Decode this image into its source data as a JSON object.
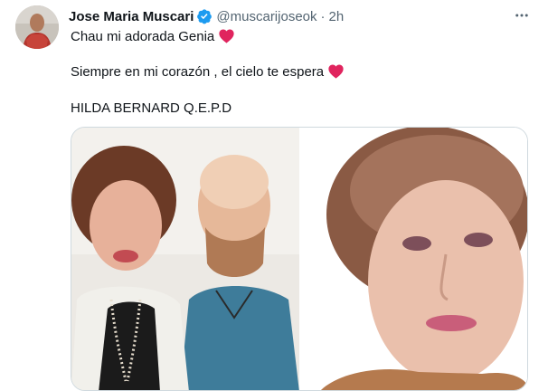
{
  "tweet": {
    "author_name": "Jose Maria Muscari",
    "handle": "@muscarijoseok",
    "separator": "·",
    "time": "2h",
    "lines": [
      "Chau mi adorada Genia",
      "Siempre en mi corazón , el cielo te espera",
      "HILDA BERNARD Q.E.P.D"
    ]
  },
  "icons": {
    "verified": "verified-badge-icon",
    "more": "more-horizontal-icon",
    "heart": "red-heart-emoji"
  },
  "colors": {
    "verified_blue": "#1d9bf0",
    "heart_red": "#e0245e",
    "secondary_text": "#536471"
  }
}
